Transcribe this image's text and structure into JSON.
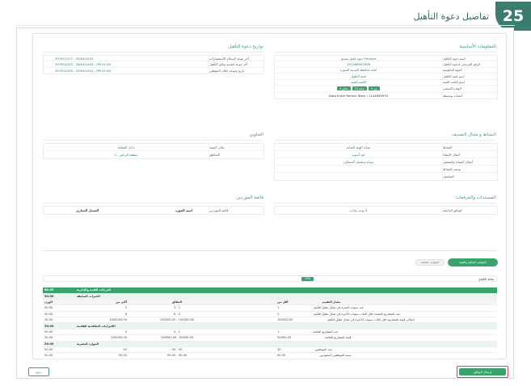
{
  "page": {
    "title": "تفاصيل دعوة التأهيل",
    "step": "25"
  },
  "basic_info": {
    "title": "المعلومات الأساسية",
    "rows": [
      {
        "label": "اسم دعوة التأهيل",
        "value": "دعوة تأهيل مسبق Finance"
      },
      {
        "label": "الرقم المرجعي لدعوة التأهيل",
        "value": "191268001906"
      },
      {
        "label": "الجهة الحكومية",
        "value": "أمانة محافظة المدينة المنورة"
      },
      {
        "label": "اسم لجنة التأهيل",
        "value": "لجنة التأهيل"
      },
      {
        "label": "اسم اللجنة الفنية",
        "value": "اللجنة الفنية"
      },
      {
        "label": "الوقت المتبقي",
        "pills": [
          "9 يوم",
          "23 ساعة",
          "4 دقائق"
        ]
      },
      {
        "label": "أنشأت بواسطة",
        "value": "Data Enter Refuut Team / 1144699970"
      }
    ]
  },
  "dates": {
    "title": "تواريخ دعوة التأهيل",
    "rows": [
      {
        "label": "آخر موعد لإستلام الاستفسارات",
        "value": "2019/12/17 - 20/04/1441"
      },
      {
        "label": "آخر موعد لتقديم وثائق التأهيل",
        "value": "2019/12/25 - 28/04/1441 - PM 01:40"
      },
      {
        "label": "تاريخ وموعد إعلان المؤهلين",
        "value": "2019/12/26 - 29/04/1441 - PM 01:40"
      }
    ]
  },
  "activity": {
    "title": "النشاط و مجال التصنيف",
    "rows": [
      {
        "label": "النشاط",
        "value": "صيانة الهيئة العدلية"
      },
      {
        "label": "أعمال الإنشاء",
        "value": "كود أسوية"
      },
      {
        "label": "أعمال الصيانة والتشغيل",
        "value": "صيانة وتشغيل المساكن"
      },
      {
        "label": "وصف النشاط",
        "value": ""
      },
      {
        "label": "التفاصيل",
        "value": ""
      }
    ]
  },
  "address": {
    "title": "العناوين",
    "rows": [
      {
        "label": "مكان التنفيذ",
        "value": "داخل المملكة"
      },
      {
        "label": "المناطق",
        "value": "1 - منطقة الرياض"
      }
    ]
  },
  "documents": {
    "title": "المستندات والمرفقات",
    "rows": [
      {
        "label": "الوثائق الداعمة",
        "value": "لا توجد بيانات"
      }
    ]
  },
  "suppliers": {
    "title": "قائمة الموردين",
    "header": [
      "قائمة الموردين",
      "اسم المورد",
      "السجل التجاري"
    ]
  },
  "tabs": {
    "active": "الجوانب المالية والفنية",
    "idle": "الجوانب المالية"
  },
  "qualification": {
    "label": "نقاط التأهيل",
    "value": "70%"
  },
  "grid": {
    "total": {
      "c1": "60.00",
      "c5": "الدرجات الفنية والإدارية"
    },
    "sections": [
      {
        "title": {
          "c1": "30.00",
          "c5": "الخبرات السابقة"
        },
        "header": {
          "c1": "الوزن",
          "c2": "أكثر من",
          "c3": "النطاق",
          "c4": "",
          "c5": "أقل من",
          "c5b": "معيار التقييم"
        },
        "rows": [
          {
            "c1": "40.00",
            "c2": "3",
            "c3": "3 - 1",
            "c4": "",
            "num": "1",
            "desc": "عدد سنوات الخبرة في مجال نطاق التأهيل"
          },
          {
            "c1": "40.00",
            "c2": "6",
            "c3": "6 - 2",
            "c4": "",
            "num": "2",
            "desc": "عدد المشاريع المنفذة خلال الثلاث سنوات الأخيرة في مجال نطاق التأهيل"
          },
          {
            "c1": "20.00",
            "c2": "1000000.00",
            "c3": "100000.00 - 100000.00",
            "c4": "",
            "num": "100000.00",
            "desc": "إجمالي قيمة المشاريع خلال الثلاث سنوات الأخيرة في مجال نطاق التأهيل"
          }
        ]
      },
      {
        "title": {
          "c1": "30.00",
          "c5": "الالتزامات التعاقدية القائمة"
        },
        "rows": [
          {
            "c1": "50.00",
            "c2": "3",
            "c3": "3 - 1",
            "c4": "",
            "num": "1",
            "desc": "عدد المشاريع القائمة"
          },
          {
            "c1": "50.00",
            "c2": "100000.00",
            "c3": "100000.00 - 50000.00",
            "c4": "",
            "num": "50000.00",
            "desc": "قيمة المشاريع القائمة"
          }
        ]
      },
      {
        "title": {
          "c1": "20.00",
          "c5": "الموارد البشرية"
        },
        "rows": [
          {
            "c1": "50.00",
            "c2": "50",
            "c3": "50 - 30",
            "c4": "",
            "num": "30",
            "desc": "عدد الموظفين"
          },
          {
            "c1": "50.00",
            "c2": "95.00",
            "c3": "95.00 - 90.00",
            "c4": "",
            "num": "90.00",
            "desc": "نسبة الموظفين السعوديين"
          }
        ]
      }
    ]
  },
  "actions": {
    "submit": "إرسال الوثائق",
    "back": "رجوع"
  }
}
